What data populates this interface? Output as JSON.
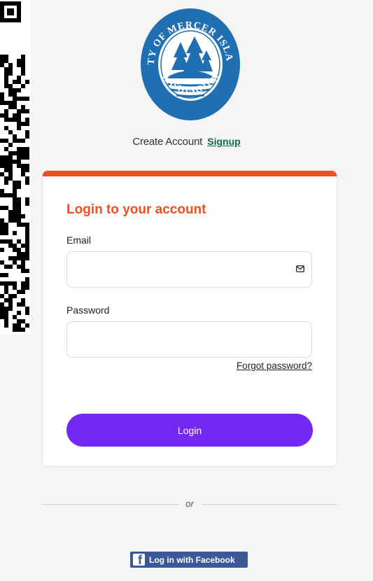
{
  "logo": {
    "top_text": "CITY OF MERCER ISLAND",
    "bottom_text": "WASHINGTON",
    "colors": {
      "primary": "#1f6fb2",
      "ring": "#ffffff",
      "tree": "#1f6fb2"
    }
  },
  "header": {
    "create_account_text": "Create Account",
    "signup_link": "Signup"
  },
  "login_card": {
    "title": "Login to your account",
    "email_label": "Email",
    "email_value": "",
    "email_icon": "mail-icon",
    "password_label": "Password",
    "password_value": "",
    "forgot_password": "Forgot password?",
    "login_button": "Login"
  },
  "divider": {
    "text": "or"
  },
  "facebook": {
    "button_label": "Log in with Facebook",
    "icon_letter": "f",
    "icon": "facebook-icon"
  },
  "colors": {
    "accent": "#f04e23",
    "button": "#7428f4",
    "link": "#0f6b3c",
    "facebook": "#3b5998"
  }
}
